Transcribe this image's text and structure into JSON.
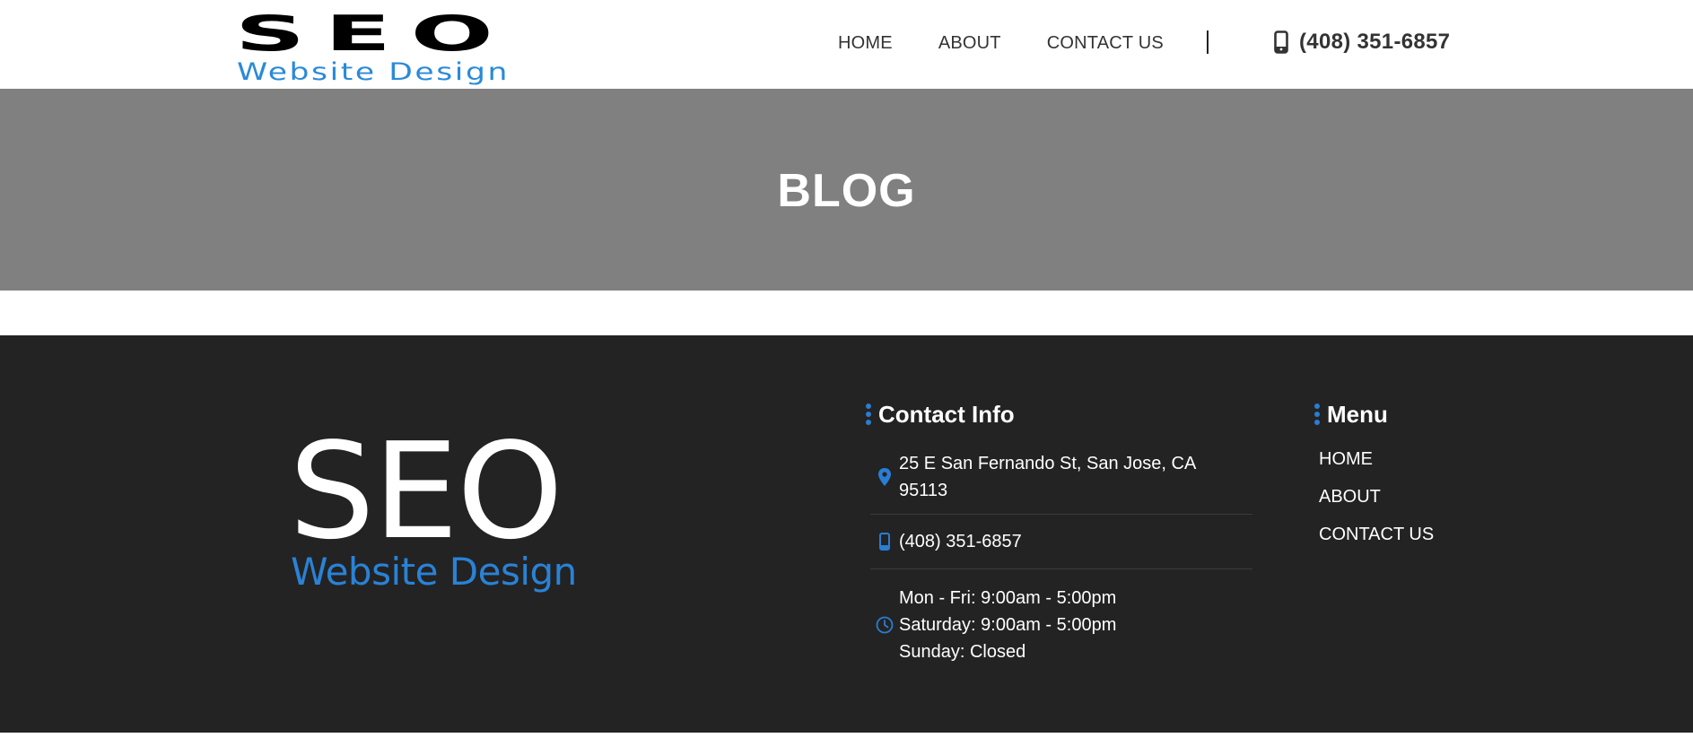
{
  "header": {
    "logo_big": "SEO",
    "logo_small": "Website Design",
    "nav": [
      {
        "label": "HOME"
      },
      {
        "label": "ABOUT"
      },
      {
        "label": "CONTACT US"
      }
    ],
    "phone": "(408) 351-6857"
  },
  "banner": {
    "title": "BLOG"
  },
  "footer": {
    "logo_big": "SEO",
    "logo_small": "Website Design",
    "contact": {
      "heading": "Contact Info",
      "address_line1": "25 E San Fernando St, San Jose, CA",
      "address_line2": "95113",
      "phone": "(408) 351-6857",
      "hours": [
        "Mon - Fri: 9:00am - 5:00pm",
        "Saturday: 9:00am - 5:00pm",
        "Sunday: Closed"
      ]
    },
    "menu": {
      "heading": "Menu",
      "items": [
        {
          "label": "HOME"
        },
        {
          "label": "ABOUT"
        },
        {
          "label": "CONTACT US"
        }
      ]
    }
  },
  "colors": {
    "accent": "#2a7dd4",
    "banner_bg": "#808080",
    "footer_bg": "#232323"
  },
  "icons": {
    "header_phone": "mobile-phone-icon",
    "address": "map-pin-icon",
    "phone": "mobile-phone-icon",
    "hours": "clock-icon",
    "heading_bullet": "vertical-dots-icon"
  }
}
